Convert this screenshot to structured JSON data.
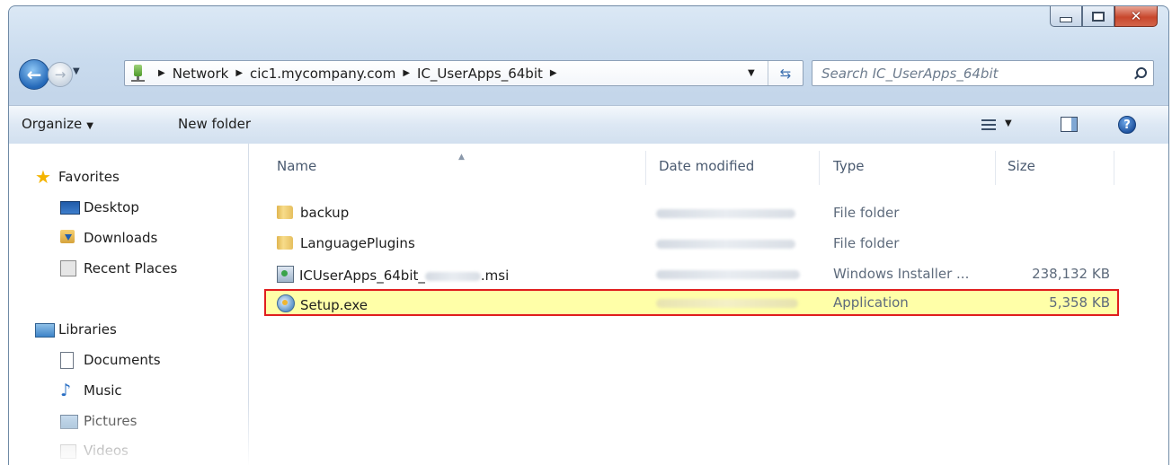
{
  "window": {
    "caption": {
      "minimize_icon": "minimize-icon",
      "maximize_icon": "maximize-icon",
      "close_glyph": "✕"
    }
  },
  "nav": {
    "back_glyph": "←",
    "forward_glyph": "→",
    "history_glyph": "▼",
    "breadcrumbs": [
      "Network",
      "cic1.mycompany.com",
      "IC_UserApps_64bit"
    ],
    "breadcrumb_sep": "▶",
    "address_dropdown_glyph": "▼",
    "refresh_glyph": "⇆"
  },
  "search": {
    "placeholder": "Search IC_UserApps_64bit"
  },
  "toolbar": {
    "organize_label": "Organize",
    "organize_caret": "▼",
    "new_folder_label": "New folder",
    "views_caret": "▼",
    "help_glyph": "?"
  },
  "sidebar": {
    "favorites": {
      "label": "Favorites",
      "items": [
        "Desktop",
        "Downloads",
        "Recent Places"
      ]
    },
    "libraries": {
      "label": "Libraries",
      "items": [
        "Documents",
        "Music",
        "Pictures",
        "Videos"
      ]
    }
  },
  "filelist": {
    "columns": {
      "name": "Name",
      "date": "Date modified",
      "type": "Type",
      "size": "Size"
    },
    "sort_glyph": "▲",
    "rows": [
      {
        "name": "backup",
        "type": "File folder",
        "size": "",
        "icon": "folder-icon"
      },
      {
        "name": "LanguagePlugins",
        "type": "File folder",
        "size": "",
        "icon": "folder-icon"
      },
      {
        "name_prefix": "ICUserApps_64bit_",
        "name_suffix": ".msi",
        "type": "Windows Installer ...",
        "size": "238,132 KB",
        "icon": "installer-icon"
      },
      {
        "name": "Setup.exe",
        "type": "Application",
        "size": "5,358 KB",
        "icon": "setup-icon",
        "highlighted": true
      }
    ]
  },
  "colors": {
    "highlight_fill": "#ffffa8",
    "highlight_border": "#e01e1e",
    "accent": "#2468b8"
  }
}
